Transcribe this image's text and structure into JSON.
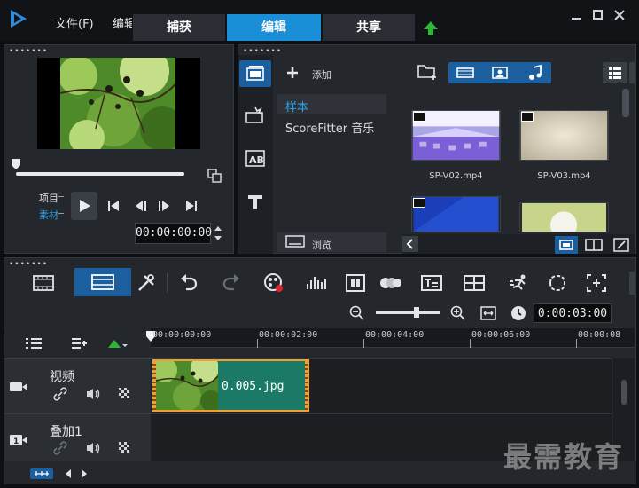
{
  "menu": {
    "file": "文件(F)",
    "edit_partial": "编辑"
  },
  "tabs": {
    "capture": "捕获",
    "edit": "编辑",
    "share": "共享"
  },
  "player": {
    "project_label": "项目",
    "clip_label": "素材",
    "timecode": "00:00:00:00"
  },
  "library": {
    "add_label": "添加",
    "items": [
      "样本",
      "ScoreFitter 音乐"
    ],
    "browse_label": "浏览",
    "thumbnails": [
      "SP-V02.mp4",
      "SP-V03.mp4"
    ]
  },
  "timeline": {
    "duration": "0:00:03:00",
    "ruler": [
      "00:00:00:00",
      "00:00:02:00",
      "00:00:04:00",
      "00:00:06:00",
      "00:00:08"
    ],
    "tracks": [
      {
        "name": "视频"
      },
      {
        "name": "叠加1"
      }
    ],
    "clip_name": "0.005.jpg"
  },
  "watermark": "最需教育",
  "colors": {
    "active_tab": "#1b8ed8",
    "toggle_blue": "#1c5f9e",
    "clip_fill": "#1a7a65",
    "clip_border": "#f0a030",
    "accent_green": "#2fb53a"
  }
}
